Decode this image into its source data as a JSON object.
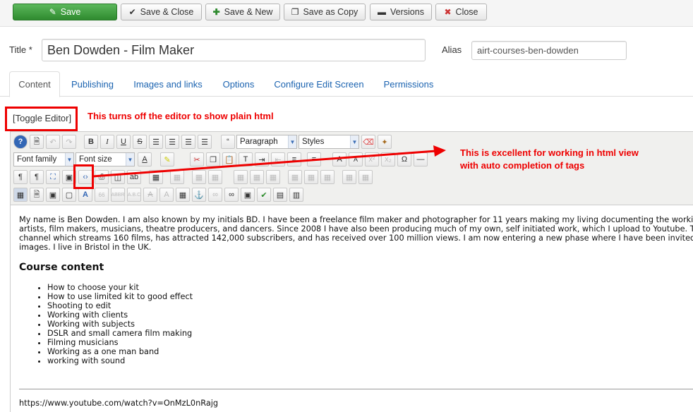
{
  "toolbar": {
    "save": "Save",
    "save_close": "Save & Close",
    "save_new": "Save & New",
    "save_copy": "Save as Copy",
    "versions": "Versions",
    "close": "Close"
  },
  "form": {
    "title_label": "Title *",
    "title_value": "Ben Dowden - Film Maker",
    "alias_label": "Alias",
    "alias_value": "airt-courses-ben-dowden"
  },
  "tabs": [
    "Content",
    "Publishing",
    "Images and links",
    "Options",
    "Configure Edit Screen",
    "Permissions"
  ],
  "toggle_editor": "[Toggle Editor]",
  "annotations": {
    "toggle_note": "This turns off the editor to show plain html",
    "code_note_line1": "This is excellent for working in html view",
    "code_note_line2": "with auto completion of tags",
    "color": "#e00000"
  },
  "editor": {
    "format_select": "Paragraph",
    "styles_select": "Styles",
    "font_family_select": "Font family",
    "font_size_select": "Font size",
    "icons": {
      "help": "help-icon",
      "new_doc": "new-document-icon",
      "undo": "undo-icon",
      "redo": "redo-icon",
      "bold": "bold-icon",
      "italic": "italic-icon",
      "underline": "underline-icon",
      "strike": "strikethrough-icon",
      "code": "code-view-icon"
    },
    "paragraph_lines": [
      "My name is Ben Dowden. I am also known by my initials BD. I have been a freelance film maker and photographer for 11 years making my living documenting the working",
      "artists, film makers, musicians, theatre producers, and dancers. Since 2008 I have also been producing much of my own, self initiated work, which I upload to Youtube. Thi",
      "channel which streams 160 films, has attracted 142,000 subscribers, and has received over 100 million views. I am now entering a new phase where I have been invited to",
      "images. I live in Bristol in the UK."
    ],
    "heading": "Course content",
    "list_items": [
      "How to choose your kit",
      "How to use limited kit to good effect",
      "Shooting to edit",
      "Working with clients",
      "Working with subjects",
      "DSLR and small camera film making",
      "Filming musicians",
      "Working as a one man band",
      "working with sound"
    ],
    "link": "https://www.youtube.com/watch?v=OnMzL0nRajg"
  }
}
